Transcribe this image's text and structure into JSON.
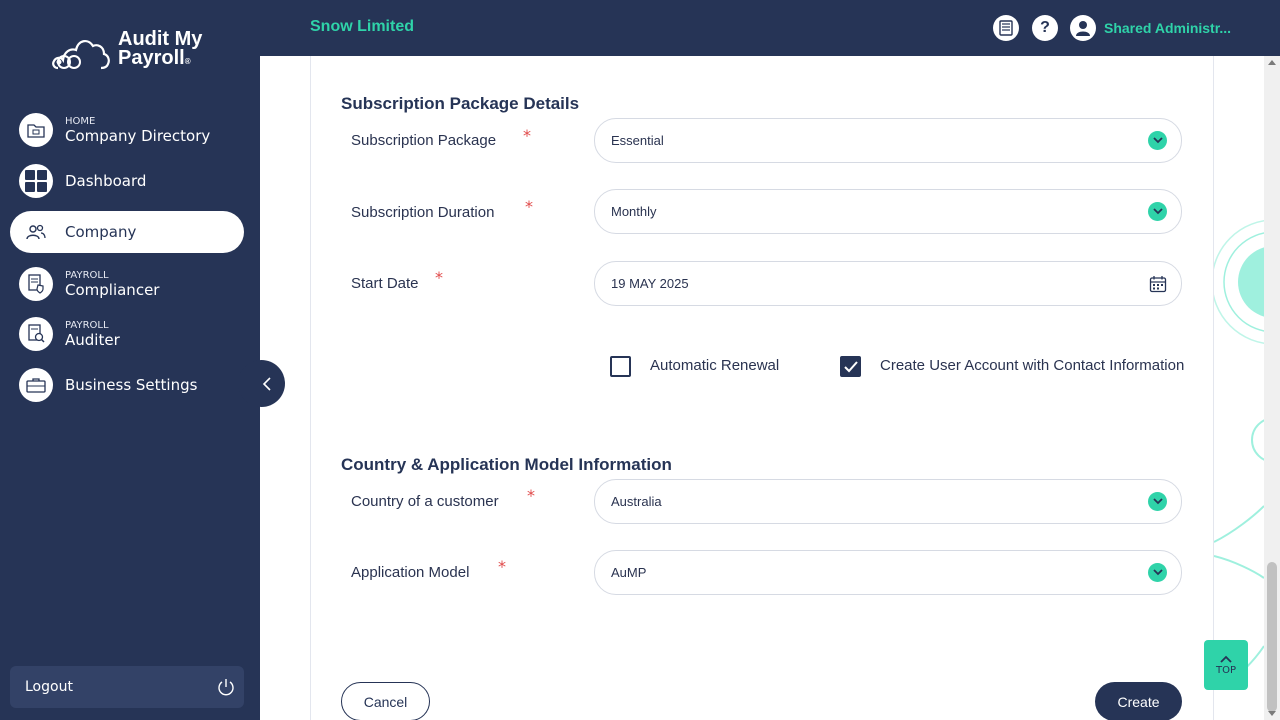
{
  "brand": {
    "line1": "Audit My",
    "line2": "Payroll",
    "mark": "®"
  },
  "colors": {
    "navy": "#263456",
    "accent": "#2fd3a9",
    "required": "#e04a4a"
  },
  "sidebar": {
    "items": [
      {
        "sub": "HOME",
        "label": "Company Directory",
        "icon": "folder-icon"
      },
      {
        "sub": "",
        "label": "Dashboard",
        "icon": "grid-icon"
      },
      {
        "sub": "",
        "label": "Company",
        "icon": "users-icon"
      },
      {
        "sub": "PAYROLL",
        "label": "Compliancer",
        "icon": "document-shield-icon"
      },
      {
        "sub": "PAYROLL",
        "label": "Auditer",
        "icon": "document-search-icon"
      },
      {
        "sub": "",
        "label": "Business Settings",
        "icon": "briefcase-icon"
      }
    ],
    "logout_label": "Logout"
  },
  "header": {
    "company": "Snow Limited",
    "user": "Shared Administr..."
  },
  "form": {
    "subscription_title": "Subscription Package Details",
    "package_label": "Subscription Package",
    "package_value": "Essential",
    "duration_label": "Subscription Duration",
    "duration_value": "Monthly",
    "start_label": "Start Date",
    "start_value": "19 MAY 2025",
    "auto_renewal_label": "Automatic Renewal",
    "auto_renewal_checked": false,
    "create_user_label": "Create User Account with Contact Information",
    "create_user_checked": true,
    "country_title": "Country & Application Model Information",
    "country_label": "Country of a customer",
    "country_value": "Australia",
    "model_label": "Application Model",
    "model_value": "AuMP",
    "required_mark": "*"
  },
  "actions": {
    "cancel": "Cancel",
    "create": "Create",
    "top": "TOP"
  }
}
